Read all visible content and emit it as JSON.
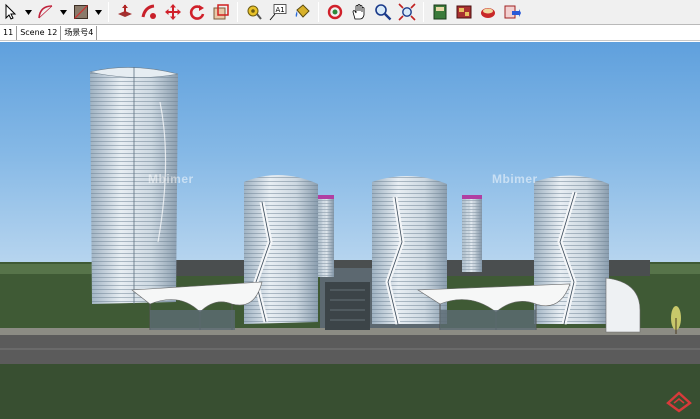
{
  "toolbar": {
    "buttons": [
      {
        "name": "select-tool",
        "icon": "arrow-cursor-icon"
      },
      {
        "name": "arc-tool",
        "icon": "arc-icon"
      },
      {
        "name": "rectangle-tool",
        "icon": "rectangle-icon"
      },
      {
        "name": "push-pull-tool",
        "icon": "push-pull-icon"
      },
      {
        "name": "follow-me-tool",
        "icon": "follow-me-icon"
      },
      {
        "name": "move-tool",
        "icon": "move-icon"
      },
      {
        "name": "rotate-tool",
        "icon": "rotate-icon"
      },
      {
        "name": "scale-tool",
        "icon": "scale-icon"
      },
      {
        "name": "tape-measure-tool",
        "icon": "tape-measure-icon"
      },
      {
        "name": "text-tool",
        "icon": "text-icon"
      },
      {
        "name": "paint-bucket-tool",
        "icon": "paint-bucket-icon"
      },
      {
        "name": "orbit-tool",
        "icon": "orbit-icon"
      },
      {
        "name": "pan-tool",
        "icon": "hand-icon"
      },
      {
        "name": "zoom-tool",
        "icon": "zoom-icon"
      },
      {
        "name": "zoom-extents-tool",
        "icon": "zoom-extents-icon"
      },
      {
        "name": "warehouse-button",
        "icon": "warehouse-icon"
      },
      {
        "name": "components-button",
        "icon": "components-icon"
      },
      {
        "name": "share-model-button",
        "icon": "share-model-icon"
      },
      {
        "name": "get-models-button",
        "icon": "get-models-icon"
      }
    ],
    "text_tool_glyph": "A1"
  },
  "tabs": [
    "11",
    "Scene 12",
    "场景号4"
  ],
  "viewport": {
    "watermarks": [
      "Mbimer",
      "Mbimer"
    ]
  },
  "colors": {
    "sky_top": "#5fa0dd",
    "sky_bottom": "#e3eef8",
    "grass": "#3f5a35",
    "road": "#5b5b5b",
    "glass": "#c9d3dc",
    "logo_red": "#d83a3a"
  }
}
